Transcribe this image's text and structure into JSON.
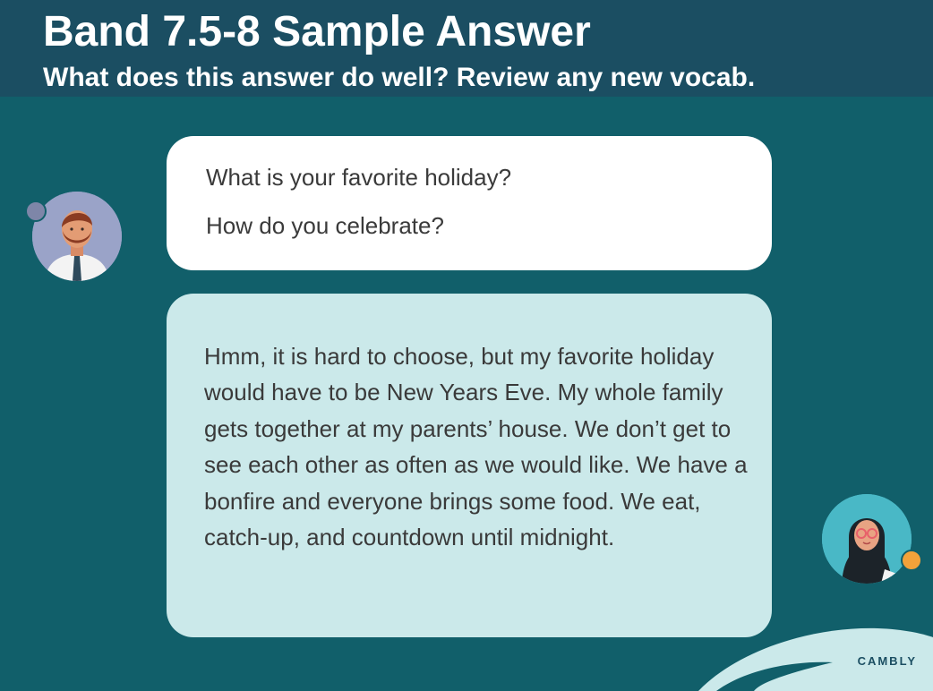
{
  "header": {
    "title": "Band 7.5-8 Sample Answer",
    "subtitle": "What does this answer do well? Review any new vocab."
  },
  "question": {
    "line1": "What is your favorite holiday?",
    "line2": "How do you celebrate?"
  },
  "answer": {
    "text": "Hmm, it is hard to choose, but my favorite holiday would have to be New Years Eve. My whole family gets together at my parents’ house. We don’t get to see each other as often as we would like. We have a bonfire and everyone brings some food. We eat, catch-up, and countdown until midnight."
  },
  "brand": {
    "name": "CAMBLY"
  },
  "colors": {
    "header_bg": "#1b4e62",
    "panel_bg": "#115f6a",
    "question_bubble": "#ffffff",
    "answer_bubble": "#cbe9ea",
    "decor_wave": "#cbe9ea"
  }
}
